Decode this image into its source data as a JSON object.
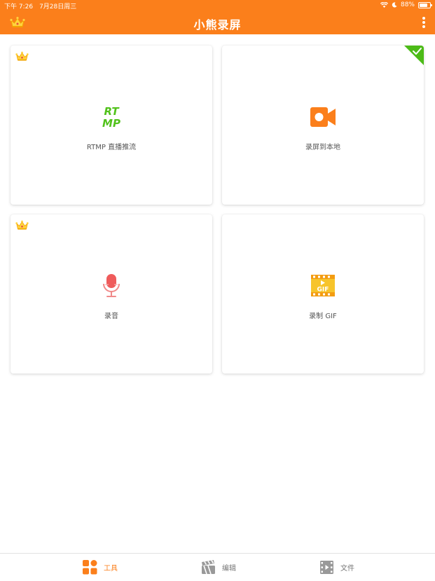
{
  "status_bar": {
    "time": "下午 7:26",
    "date": "7月28日周三",
    "battery": "88%"
  },
  "app_bar": {
    "title": "小熊录屏"
  },
  "cards": {
    "rtmp": {
      "label": "RTMP 直播推流",
      "icon_text_top": "RT",
      "icon_text_bottom": "MP",
      "icon": "rtmp-icon",
      "premium": true
    },
    "record_local": {
      "label": "录屏到本地",
      "icon": "video-camera-icon",
      "selected": true
    },
    "audio": {
      "label": "录音",
      "icon": "microphone-icon",
      "premium": true
    },
    "gif": {
      "label": "录制 GIF",
      "icon": "gif-icon",
      "icon_text": "GIF"
    }
  },
  "tabs": [
    {
      "label": "工具",
      "icon": "grid-icon",
      "active": true
    },
    {
      "label": "编辑",
      "icon": "clapperboard-icon",
      "active": false
    },
    {
      "label": "文件",
      "icon": "film-icon",
      "active": false
    }
  ],
  "colors": {
    "brand": "#fb7f1b",
    "rtmp_green": "#52c21c",
    "selected_green": "#4cbb17",
    "mic_red": "#ef5b5b",
    "gif_yellow": "#f7c42b"
  }
}
